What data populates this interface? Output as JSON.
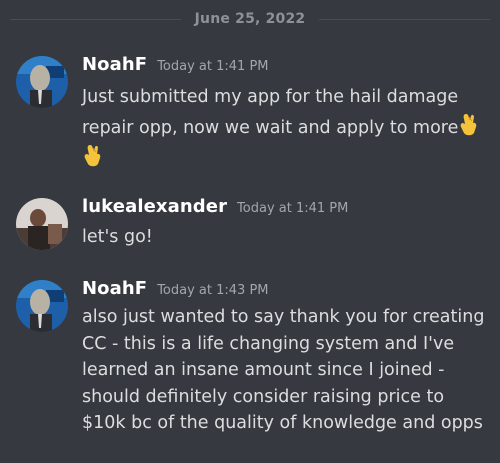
{
  "date_divider": "June 25, 2022",
  "messages": [
    {
      "author": "NoahF",
      "timestamp": "Today at 1:41 PM",
      "text": "Just submitted my app for the hail damage repair opp, now we wait and apply to more",
      "emoji": [
        "fingers-crossed-icon",
        "fingers-crossed-icon"
      ]
    },
    {
      "author": "lukealexander",
      "timestamp": "Today at 1:41 PM",
      "text": "let's go!"
    },
    {
      "author": "NoahF",
      "timestamp": "Today at 1:43 PM",
      "text": "also just wanted to say thank you for creating CC - this is a life changing system and I've learned an insane amount since I joined - should definitely consider raising price to $10k bc of the quality of knowledge and opps"
    }
  ],
  "colors": {
    "background": "#36393f",
    "author": "#ffffff",
    "text": "#dcddde",
    "timestamp": "#a3a6aa",
    "emoji": "#f5c33b"
  }
}
